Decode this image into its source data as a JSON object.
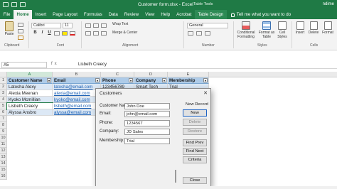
{
  "window": {
    "title": "Customer form.xlsx  -  Excel",
    "table_tools": "Table Tools",
    "user": "ndime"
  },
  "tabs": [
    "File",
    "Home",
    "Insert",
    "Page Layout",
    "Formulas",
    "Data",
    "Review",
    "View",
    "Help",
    "Acrobat",
    "Table Design"
  ],
  "tell_me": "Tell me what you want to do",
  "ribbon": {
    "paste": "Paste",
    "clipboard": "Clipboard",
    "font_name": "Calibri",
    "font_size": "11",
    "font_group": "Font",
    "bold": "B",
    "italic": "I",
    "underline": "U",
    "wrap_text": "Wrap Text",
    "merge_center": "Merge & Center",
    "alignment": "Alignment",
    "number_format": "General",
    "number": "Number",
    "conditional_formatting": "Conditional Formatting",
    "format_as_table": "Format as Table",
    "cell_styles": "Cell Styles",
    "styles": "Styles",
    "insert": "Insert",
    "delete": "Delete",
    "format": "Format",
    "cells": "Cells"
  },
  "formula_bar": {
    "name_box": "A5",
    "fx": "fx",
    "value": "Lisbeth Creecy"
  },
  "grid": {
    "columns": [
      "A",
      "B",
      "C",
      "D",
      "E"
    ],
    "row_numbers": [
      "1",
      "2",
      "3",
      "4",
      "5",
      "6",
      "7",
      "8",
      "9",
      "10",
      "11",
      "12",
      "13",
      "14",
      "15",
      "16"
    ],
    "headers": [
      "Customer Name",
      "Email",
      "Phone",
      "Company",
      "Membership"
    ],
    "rows": [
      [
        "Latosha Alexy",
        "latosha@email.com",
        "123456789",
        "Smart Tech",
        "Trial"
      ],
      [
        "Alexia Meenan",
        "alexia@email.com",
        "",
        "",
        ""
      ],
      [
        "Kyoko Mcmillian",
        "kyoko@email.com",
        "",
        "",
        ""
      ],
      [
        "Lisbeth Creecy",
        "lisbeth@email.com",
        "",
        "",
        ""
      ],
      [
        "Alyssa Ansbro",
        "alyssa@email.com",
        "",
        "",
        ""
      ]
    ]
  },
  "dialog": {
    "title": "Customers",
    "close": "✕",
    "record_label": "New Record",
    "fields": [
      {
        "label": "Customer Name:",
        "value": "John Doe"
      },
      {
        "label": "Email:",
        "value": "john@email.com"
      },
      {
        "label": "Phone:",
        "value": "1234567"
      },
      {
        "label": "Company:",
        "value": "JD Sales"
      },
      {
        "label": "Membership:",
        "value": "Trial"
      }
    ],
    "buttons": [
      "New",
      "Delete",
      "Restore",
      "Find Prev",
      "Find Next",
      "Criteria",
      "Close"
    ]
  },
  "colors": {
    "excel_green": "#1f7a45",
    "table_header": "#aecbe8",
    "table_band": "#dce8f5"
  }
}
